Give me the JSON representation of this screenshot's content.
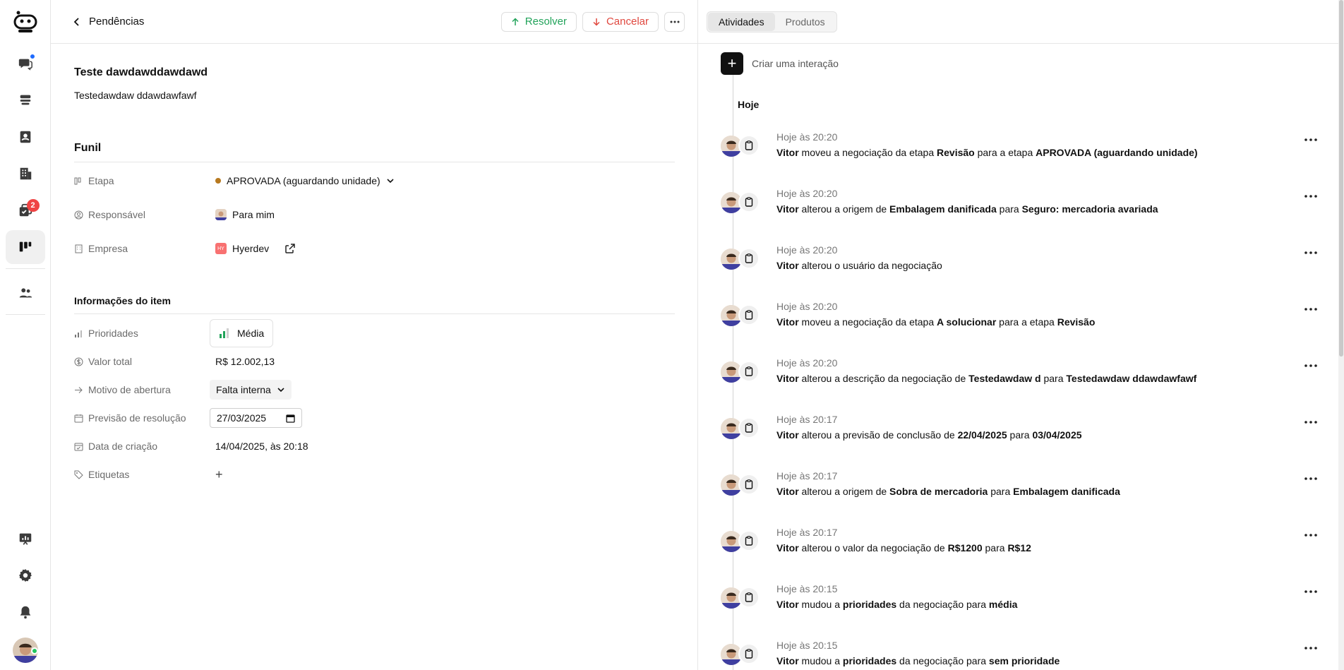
{
  "header": {
    "back_label": "Pendências",
    "resolve_label": "Resolver",
    "cancel_label": "Cancelar"
  },
  "rail": {
    "task_badge": "2"
  },
  "deal": {
    "title": "Teste dawdawddawdawd",
    "description": "Testedawdaw ddawdawfawf"
  },
  "funnel": {
    "heading": "Funil",
    "stage_label": "Etapa",
    "stage_value": "APROVADA (aguardando unidade)",
    "owner_label": "Responsável",
    "owner_value": "Para mim",
    "company_label": "Empresa",
    "company_chip": "HY",
    "company_value": "Hyerdev"
  },
  "item_info": {
    "heading": "Informações do item",
    "priority_label": "Prioridades",
    "priority_value": "Média",
    "total_label": "Valor total",
    "total_value": "R$ 12.002,13",
    "reason_label": "Motivo de abertura",
    "reason_value": "Falta interna",
    "forecast_label": "Previsão de resolução",
    "forecast_value": "27/03/2025",
    "created_label": "Data de criação",
    "created_value": "14/04/2025, às 20:18",
    "tags_label": "Etiquetas"
  },
  "right": {
    "tabs": [
      "Atividades",
      "Produtos"
    ],
    "create_label": "Criar uma interação",
    "day_label": "Hoje"
  },
  "activities": [
    {
      "time": "Hoje às 20:20",
      "parts": [
        [
          "b",
          "Vitor"
        ],
        [
          "t",
          " moveu a negociação da etapa "
        ],
        [
          "b",
          "Revisão"
        ],
        [
          "t",
          " para a etapa "
        ],
        [
          "b",
          "APROVADA (aguardando unidade)"
        ]
      ]
    },
    {
      "time": "Hoje às 20:20",
      "parts": [
        [
          "b",
          "Vitor"
        ],
        [
          "t",
          " alterou a origem de "
        ],
        [
          "b",
          "Embalagem danificada"
        ],
        [
          "t",
          " para "
        ],
        [
          "b",
          "Seguro: mercadoria avariada"
        ]
      ]
    },
    {
      "time": "Hoje às 20:20",
      "parts": [
        [
          "b",
          "Vitor"
        ],
        [
          "t",
          " alterou o usuário da negociação"
        ]
      ]
    },
    {
      "time": "Hoje às 20:20",
      "parts": [
        [
          "b",
          "Vitor"
        ],
        [
          "t",
          " moveu a negociação da etapa "
        ],
        [
          "b",
          "A solucionar"
        ],
        [
          "t",
          " para a etapa "
        ],
        [
          "b",
          "Revisão"
        ]
      ]
    },
    {
      "time": "Hoje às 20:20",
      "parts": [
        [
          "b",
          "Vitor"
        ],
        [
          "t",
          " alterou a descrição da negociação de "
        ],
        [
          "b",
          "Testedawdaw d"
        ],
        [
          "t",
          " para "
        ],
        [
          "b",
          "Testedawdaw ddawdawfawf"
        ]
      ]
    },
    {
      "time": "Hoje às 20:17",
      "parts": [
        [
          "b",
          "Vitor"
        ],
        [
          "t",
          " alterou a previsão de conclusão de "
        ],
        [
          "b",
          "22/04/2025"
        ],
        [
          "t",
          " para "
        ],
        [
          "b",
          "03/04/2025"
        ]
      ]
    },
    {
      "time": "Hoje às 20:17",
      "parts": [
        [
          "b",
          "Vitor"
        ],
        [
          "t",
          " alterou a origem de "
        ],
        [
          "b",
          "Sobra de mercadoria"
        ],
        [
          "t",
          " para "
        ],
        [
          "b",
          "Embalagem danificada"
        ]
      ]
    },
    {
      "time": "Hoje às 20:17",
      "parts": [
        [
          "b",
          "Vitor"
        ],
        [
          "t",
          " alterou o valor da negociação de "
        ],
        [
          "b",
          "R$1200"
        ],
        [
          "t",
          " para "
        ],
        [
          "b",
          "R$12"
        ]
      ]
    },
    {
      "time": "Hoje às 20:15",
      "parts": [
        [
          "b",
          "Vitor"
        ],
        [
          "t",
          " mudou a "
        ],
        [
          "b",
          "prioridades"
        ],
        [
          "t",
          " da negociação para "
        ],
        [
          "b",
          "média"
        ]
      ]
    },
    {
      "time": "Hoje às 20:15",
      "parts": [
        [
          "b",
          "Vitor"
        ],
        [
          "t",
          " mudou a "
        ],
        [
          "b",
          "prioridades"
        ],
        [
          "t",
          " da negociação para "
        ],
        [
          "b",
          "sem prioridade"
        ]
      ]
    }
  ],
  "colors": {
    "resolve": "#22a35a",
    "cancel": "#e0483f",
    "stage_dot": "#b7791f",
    "badge": "#ef4444"
  }
}
